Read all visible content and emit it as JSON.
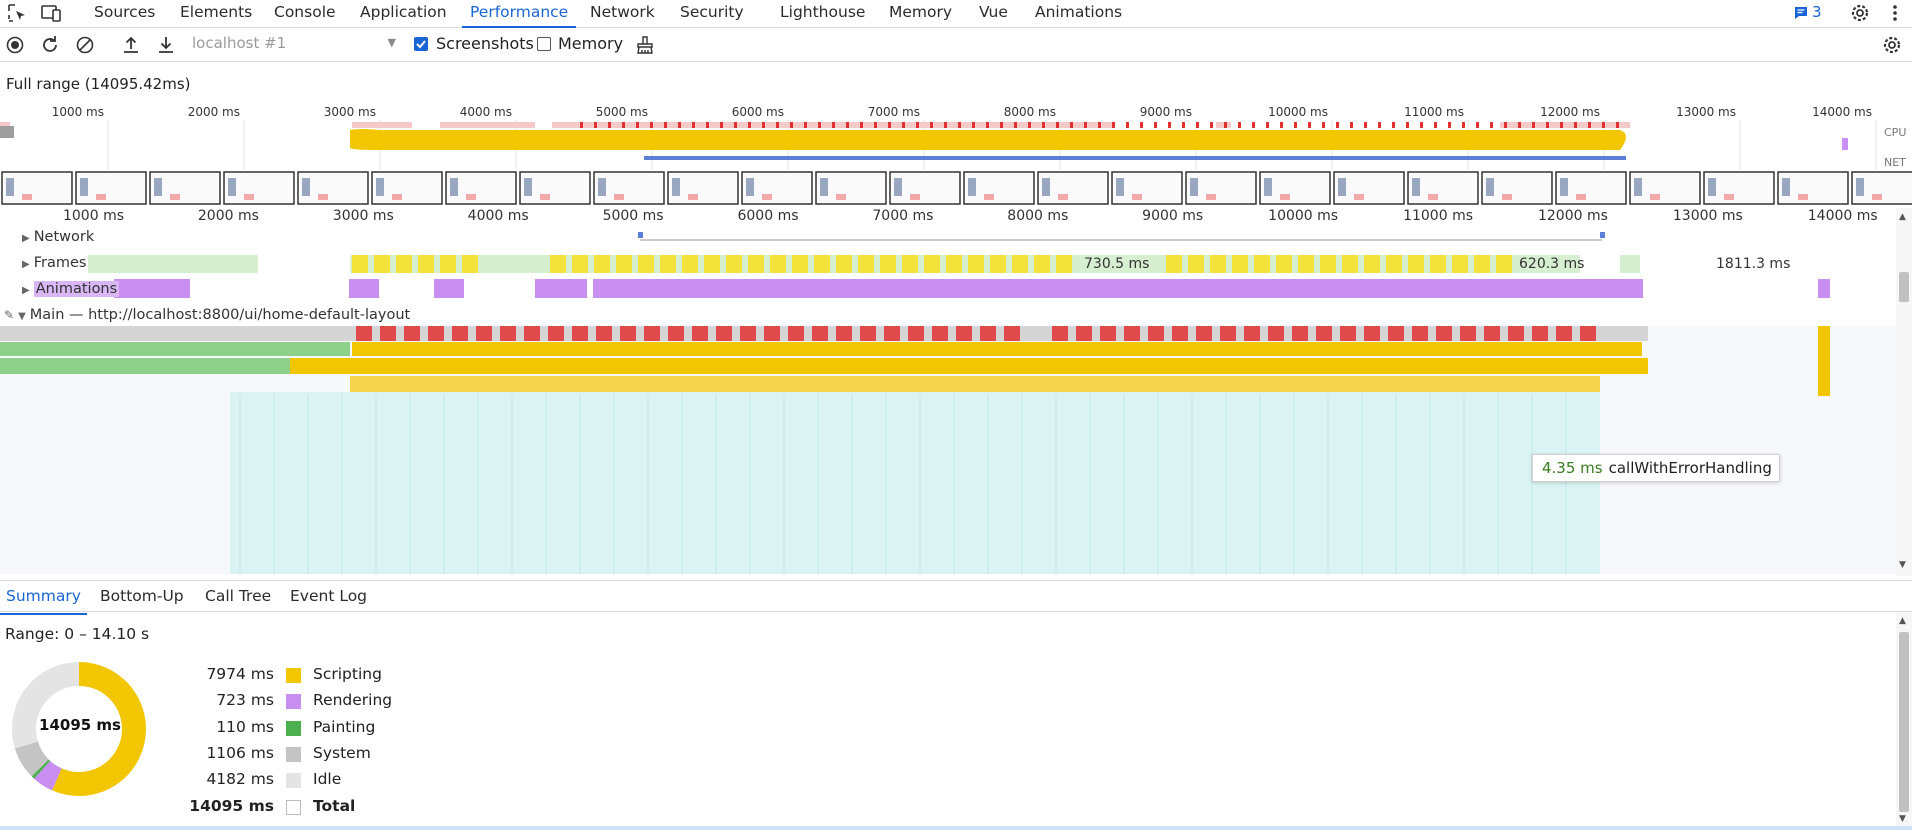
{
  "tabs": [
    {
      "label": "Sources"
    },
    {
      "label": "Elements"
    },
    {
      "label": "Console"
    },
    {
      "label": "Application"
    },
    {
      "label": "Performance",
      "active": true
    },
    {
      "label": "Network"
    },
    {
      "label": "Security"
    },
    {
      "label": "Lighthouse"
    },
    {
      "label": "Memory"
    },
    {
      "label": "Vue"
    },
    {
      "label": "Animations"
    }
  ],
  "issues_count": "3",
  "toolbar": {
    "target": "localhost #1",
    "screenshots_label": "Screenshots",
    "screenshots_checked": true,
    "memory_label": "Memory",
    "memory_checked": false
  },
  "full_range": "Full range (14095.42ms)",
  "overview": {
    "ticks": [
      "1000 ms",
      "2000 ms",
      "3000 ms",
      "4000 ms",
      "5000 ms",
      "6000 ms",
      "7000 ms",
      "8000 ms",
      "9000 ms",
      "10000 ms",
      "11000 ms",
      "12000 ms",
      "13000 ms",
      "14000 ms"
    ],
    "cpu_label": "CPU",
    "net_label": "NET"
  },
  "ruler": {
    "ticks": [
      "1000 ms",
      "2000 ms",
      "3000 ms",
      "4000 ms",
      "5000 ms",
      "6000 ms",
      "7000 ms",
      "8000 ms",
      "9000 ms",
      "10000 ms",
      "11000 ms",
      "12000 ms",
      "13000 ms",
      "14000 ms"
    ]
  },
  "tracks": {
    "network": "Network",
    "frames": "Frames",
    "animations": "Animations",
    "main": "Main — http://localhost:8800/ui/home-default-layout",
    "frame_labels": [
      "730.5 ms",
      "620.3 ms",
      "1811.3 ms"
    ]
  },
  "tooltip": {
    "duration": "4.35 ms",
    "name": "callWithErrorHandling"
  },
  "bottom_tabs": [
    {
      "label": "Summary",
      "active": true
    },
    {
      "label": "Bottom-Up"
    },
    {
      "label": "Call Tree"
    },
    {
      "label": "Event Log"
    }
  ],
  "summary": {
    "range": "Range: 0 – 14.10 s",
    "total_label": "14095 ms",
    "rows": [
      {
        "value": "7974 ms",
        "name": "Scripting",
        "color": "#f2c600",
        "ms": 7974
      },
      {
        "value": "723 ms",
        "name": "Rendering",
        "color": "#c88ef0",
        "ms": 723
      },
      {
        "value": "110 ms",
        "name": "Painting",
        "color": "#4caf50",
        "ms": 110
      },
      {
        "value": "1106 ms",
        "name": "System",
        "color": "#c4c4c4",
        "ms": 1106
      },
      {
        "value": "4182 ms",
        "name": "Idle",
        "color": "#e4e4e4",
        "ms": 4182
      }
    ],
    "total": {
      "value": "14095 ms",
      "name": "Total"
    }
  }
}
